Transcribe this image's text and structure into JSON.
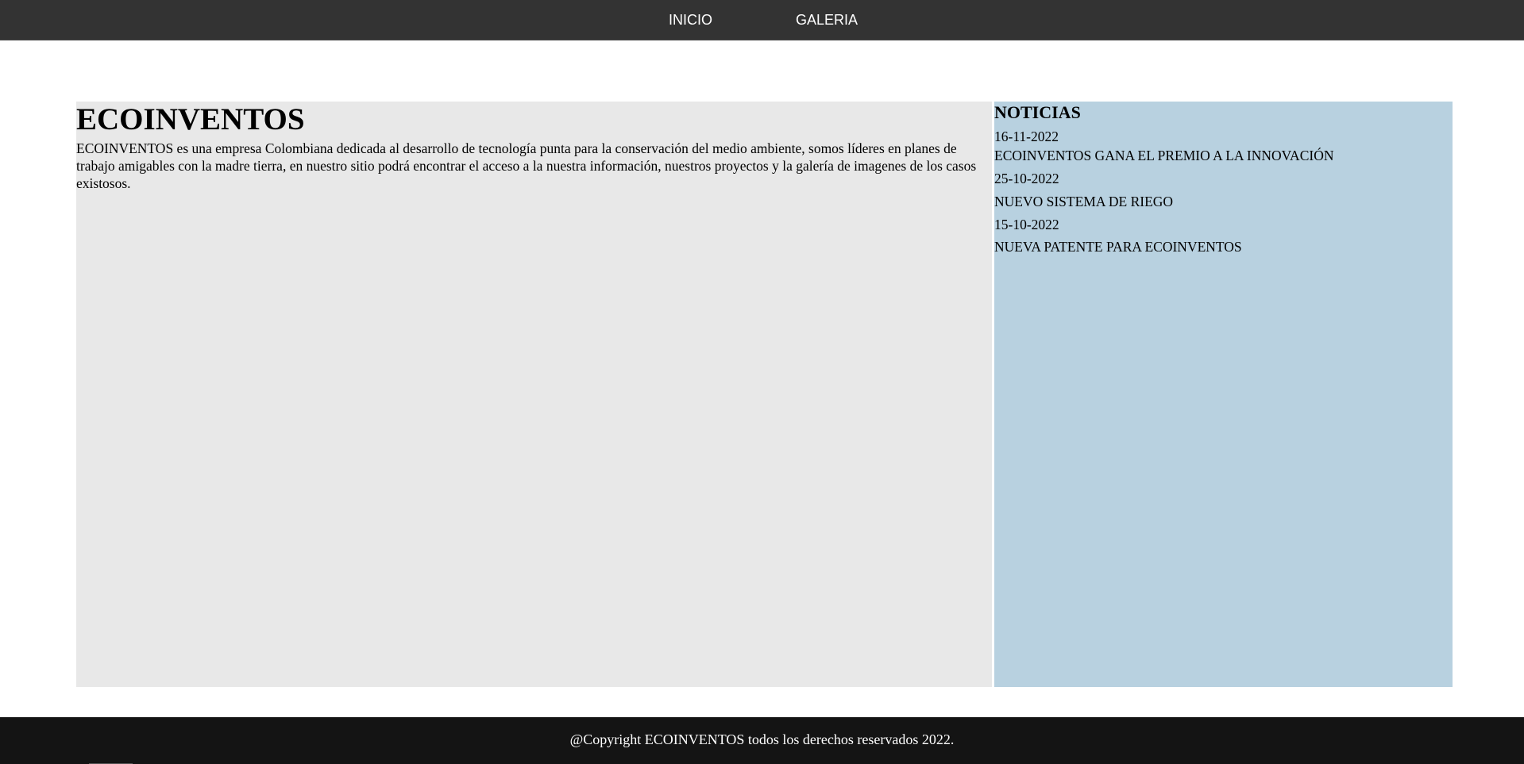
{
  "nav": {
    "items": [
      {
        "label": "INICIO"
      },
      {
        "label": "GALERIA"
      }
    ]
  },
  "main": {
    "title": "ECOINVENTOS",
    "text": "ECOINVENTOS es una empresa Colombiana dedicada al desarrollo de tecnología punta para la conservación del medio ambiente, somos líderes en planes de trabajo amigables con la madre tierra, en nuestro sitio podrá encontrar el acceso a la nuestra información, nuestros proyectos y la galería de imagenes de los casos existosos."
  },
  "news": {
    "title": "NOTICIAS",
    "items": [
      {
        "date": "16-11-2022",
        "headline": "ECOINVENTOS GANA EL PREMIO A LA INNOVACIÓN"
      },
      {
        "date": "25-10-2022",
        "headline": "NUEVO SISTEMA DE RIEGO"
      },
      {
        "date": "15-10-2022",
        "headline": "NUEVA PATENTE PARA ECOINVENTOS"
      }
    ]
  },
  "footer": {
    "text": "@Copyright ECOINVENTOS todos los derechos reservados 2022."
  },
  "colors": {
    "nav_bg": "#333333",
    "main_bg": "#e8e8e8",
    "news_bg": "#b8d1e0",
    "footer_bg": "#141414"
  }
}
